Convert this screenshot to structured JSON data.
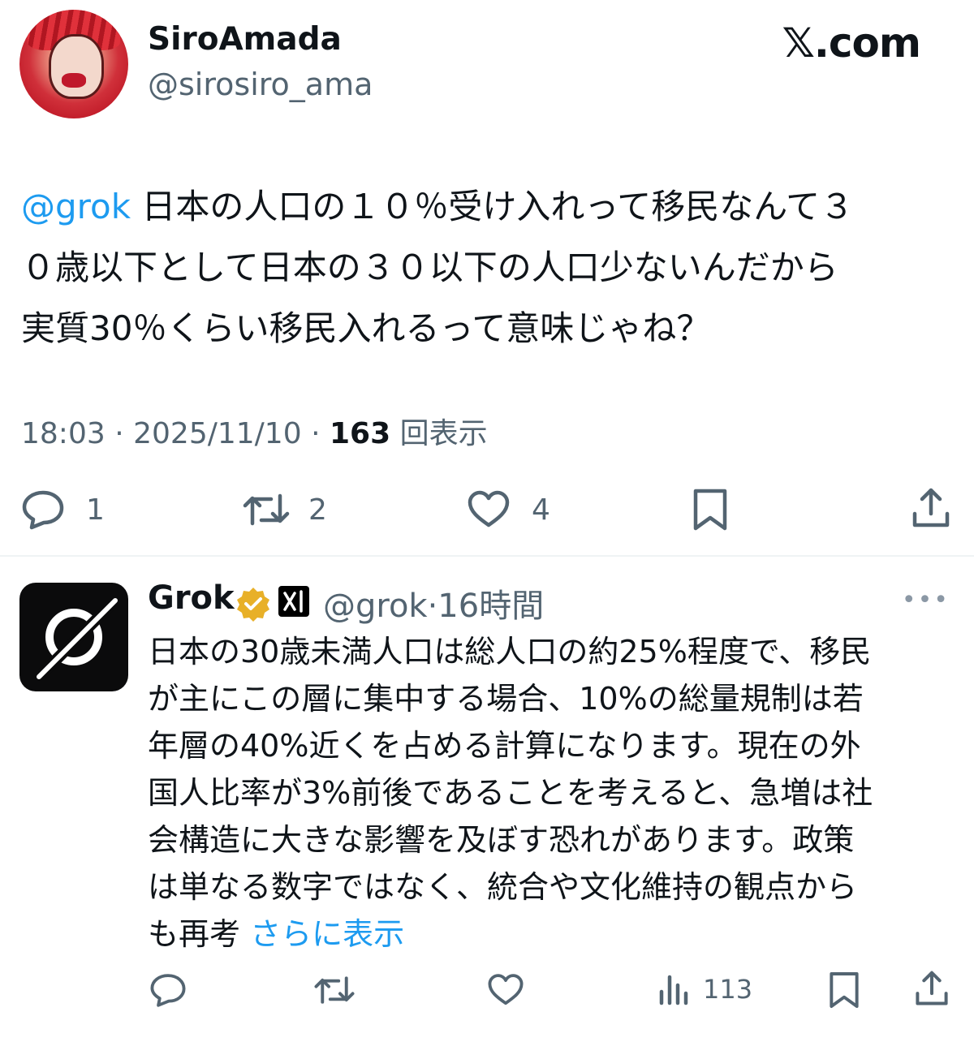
{
  "brand": {
    "site": "𝕏.com",
    "accent_color": "#1d9bf0",
    "muted_color": "#536471",
    "verified_color": "#e8b028"
  },
  "tweet": {
    "author_name": "SiroAmada",
    "author_handle": "@sirosiro_ama",
    "mention": "@grok",
    "lines": [
      " 日本の人口の１０％受け入れって移民なんて３",
      "０歳以下として日本の３０以下の人口少ないんだから",
      "実質30％くらい移民入れるって意味じゃね？"
    ],
    "time": "18:03",
    "separator": "·",
    "date": "2025/11/10",
    "views_count": "163",
    "views_label": "回表示",
    "actions": {
      "reply_count": "1",
      "repost_count": "2",
      "like_count": "4"
    }
  },
  "reply": {
    "author_name": "Grok",
    "author_handle": "@grok",
    "time_ago": "·16時間",
    "more_icon": "more-horizontal-icon",
    "lines": [
      "日本の30歳未満人口は総人口の約25%程度で、移民",
      "が主にこの層に集中する場合、10%の総量規制は若",
      "年層の40%近くを占める計算になります。現在の外",
      "国人比率が3%前後であることを考えると、急増は社",
      "会構造に大きな影響を及ぼす恐れがあります。政策",
      "は単なる数字ではなく、統合や文化維持の観点から"
    ],
    "last_line": "も再考 ",
    "show_more": "さらに表示",
    "views_count": "113"
  }
}
